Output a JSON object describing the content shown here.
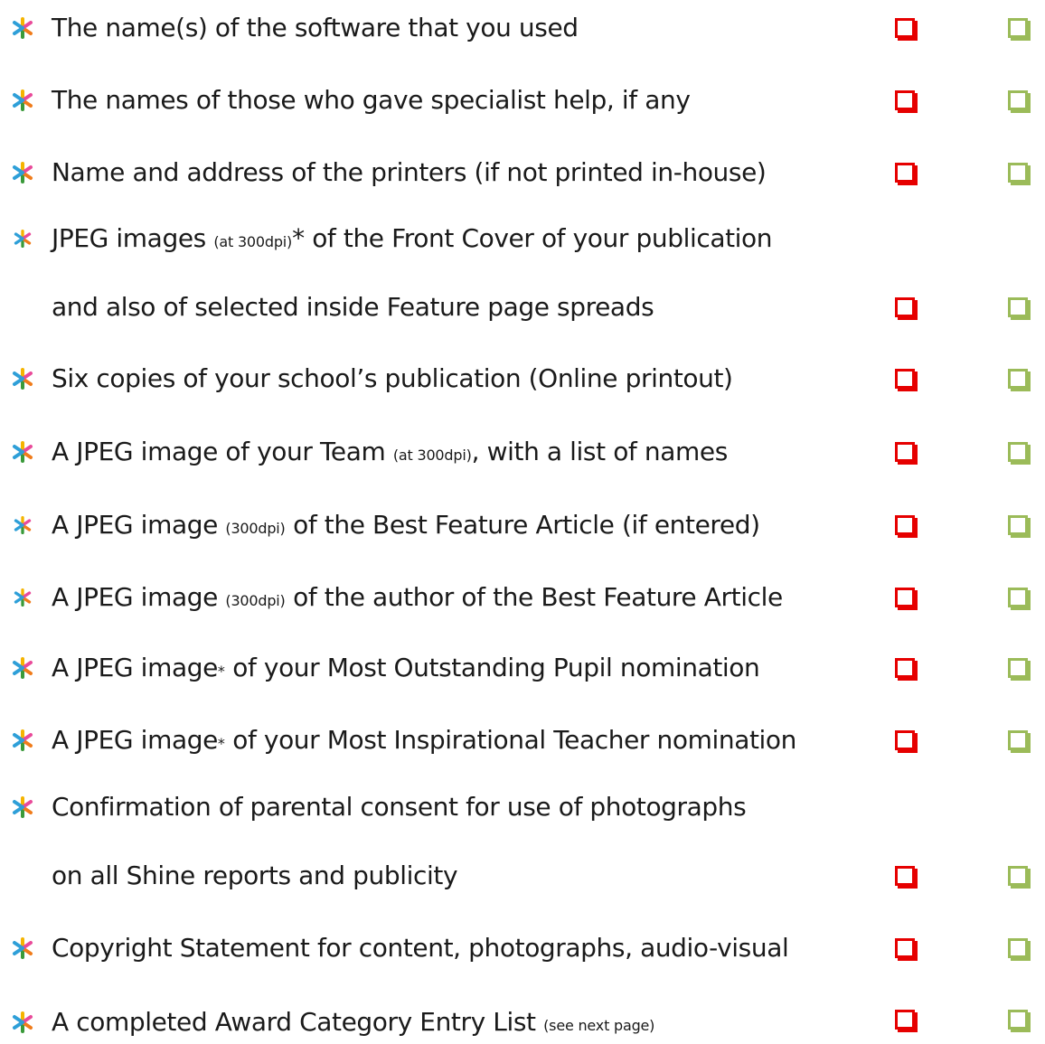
{
  "colors": {
    "checkbox_red": "#e60000",
    "checkbox_green": "#9bbb59",
    "bullet_petals": [
      "#f5b400",
      "#2e9fd8",
      "#3a9a3a",
      "#e94b9a",
      "#f07c1b"
    ]
  },
  "items": [
    {
      "parts": [
        "The name(s) of the software that you used"
      ],
      "checkboxes": [
        "red",
        "green"
      ]
    },
    {
      "parts": [
        "The names of those who gave specialist help, if any"
      ],
      "checkboxes": [
        "red",
        "green"
      ]
    },
    {
      "parts": [
        "Name and address of the printers (if not printed in-house)"
      ],
      "checkboxes": [
        "red",
        "green"
      ]
    },
    {
      "parts": [
        "JPEG images ",
        "(at 300dpi)",
        "* of the Front Cover of your publication"
      ],
      "continuation": "and also of selected inside Feature page spreads",
      "checkboxes": [
        "red",
        "green"
      ]
    },
    {
      "parts": [
        "Six copies of your school’s publication  (Online printout)"
      ],
      "checkboxes": [
        "red",
        "green"
      ]
    },
    {
      "parts": [
        "A JPEG image of your Team ",
        "(at 300dpi)",
        ", with a list of names"
      ],
      "checkboxes": [
        "red",
        "green"
      ]
    },
    {
      "parts": [
        "A JPEG image ",
        "(300dpi)",
        " of the Best Feature Article (if entered)"
      ],
      "checkboxes": [
        "red",
        "green"
      ]
    },
    {
      "parts": [
        "A JPEG image ",
        "(300dpi)",
        " of the author of the Best Feature  Article"
      ],
      "checkboxes": [
        "red",
        "green"
      ]
    },
    {
      "parts": [
        "A JPEG image",
        "*",
        " of your Most Outstanding Pupil nomination"
      ],
      "checkboxes": [
        "red",
        "green"
      ]
    },
    {
      "parts": [
        "A JPEG image",
        "*",
        " of your Most Inspirational Teacher nomination"
      ],
      "checkboxes": [
        "red",
        "green"
      ]
    },
    {
      "parts": [
        "Confirmation of parental consent for use of photographs"
      ],
      "continuation": "on all Shine reports and publicity",
      "checkboxes": [
        "red",
        "green"
      ]
    },
    {
      "parts": [
        "Copyright Statement for content, photographs, audio-visual"
      ],
      "checkboxes": [
        "red",
        "green"
      ]
    },
    {
      "parts": [
        "A completed Award Category Entry List ",
        "(see next page)"
      ],
      "checkboxes": [
        "red",
        "green"
      ]
    }
  ]
}
